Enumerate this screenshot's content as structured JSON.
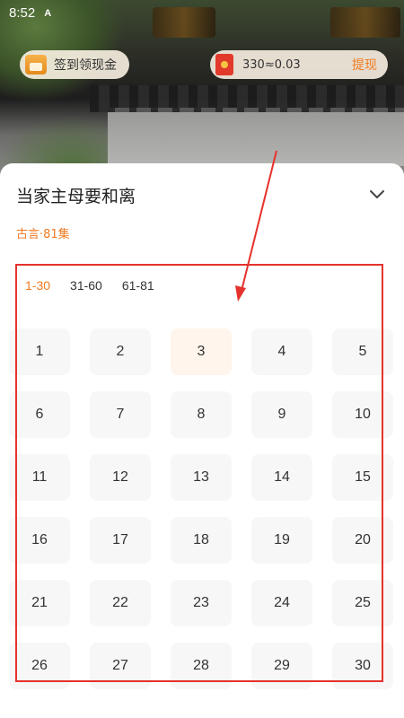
{
  "status_bar": {
    "time": "8:52",
    "app_icon": "A"
  },
  "header": {
    "checkin_label": "签到领现金",
    "checkin_icon": "calendar-icon",
    "wallet_amount": "330≈0.03",
    "wallet_icon": "red-envelope-icon",
    "withdraw_label": "提现"
  },
  "sheet": {
    "title": "当家主母要和离",
    "meta": "古言·81集",
    "ranges": [
      {
        "label": "1-30",
        "active": true
      },
      {
        "label": "31-60",
        "active": false
      },
      {
        "label": "61-81",
        "active": false
      }
    ],
    "current_episode": "3",
    "episodes": [
      "1",
      "2",
      "3",
      "4",
      "5",
      "6",
      "7",
      "8",
      "9",
      "10",
      "11",
      "12",
      "13",
      "14",
      "15",
      "16",
      "17",
      "18",
      "19",
      "20",
      "21",
      "22",
      "23",
      "24",
      "25",
      "26",
      "27",
      "28",
      "29",
      "30"
    ]
  },
  "colors": {
    "accent": "#f07a22",
    "annotation": "#e5322d"
  }
}
